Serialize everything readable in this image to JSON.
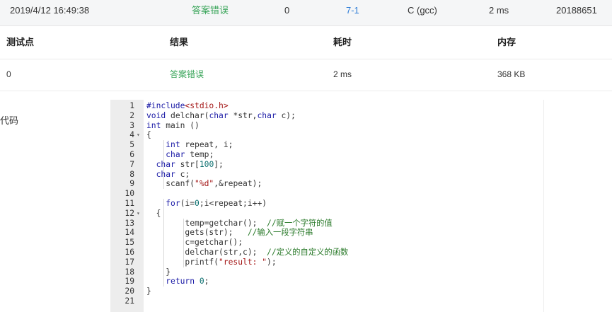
{
  "submission": {
    "time": "2019/4/12 16:49:38",
    "status": "答案错误",
    "score": "0",
    "problem": "7-1",
    "compiler": "C (gcc)",
    "runtime": "2 ms",
    "user": "20188651"
  },
  "table": {
    "headers": [
      "测试点",
      "结果",
      "耗时",
      "内存"
    ],
    "rows": [
      {
        "point": "0",
        "result": "答案错误",
        "time": "2 ms",
        "memory": "368 KB"
      }
    ]
  },
  "code_section": {
    "label": "代码",
    "lines": [
      {
        "n": "1",
        "fold": false,
        "code": "#include<stdio.h>"
      },
      {
        "n": "2",
        "fold": false,
        "code": "void delchar(char *str,char c);"
      },
      {
        "n": "3",
        "fold": false,
        "code": "int main ()"
      },
      {
        "n": "4",
        "fold": true,
        "code": "{"
      },
      {
        "n": "5",
        "fold": false,
        "code": "    int repeat, i;"
      },
      {
        "n": "6",
        "fold": false,
        "code": "    char temp;"
      },
      {
        "n": "7",
        "fold": false,
        "code": "  char str[100];"
      },
      {
        "n": "8",
        "fold": false,
        "code": "  char c;"
      },
      {
        "n": "9",
        "fold": false,
        "code": "    scanf(\"%d\",&repeat);"
      },
      {
        "n": "10",
        "fold": false,
        "code": ""
      },
      {
        "n": "11",
        "fold": false,
        "code": "    for(i=0;i<repeat;i++)"
      },
      {
        "n": "12",
        "fold": true,
        "code": "  {"
      },
      {
        "n": "13",
        "fold": false,
        "code": "        temp=getchar();  //赋一个字符的值"
      },
      {
        "n": "14",
        "fold": false,
        "code": "        gets(str);   //输入一段字符串"
      },
      {
        "n": "15",
        "fold": false,
        "code": "        c=getchar();"
      },
      {
        "n": "16",
        "fold": false,
        "code": "        delchar(str,c);  //定义的自定义的函数"
      },
      {
        "n": "17",
        "fold": false,
        "code": "        printf(\"result: \");"
      },
      {
        "n": "18",
        "fold": false,
        "code": "    }"
      },
      {
        "n": "19",
        "fold": false,
        "code": "    return 0;"
      },
      {
        "n": "20",
        "fold": false,
        "code": "}"
      },
      {
        "n": "21",
        "fold": false,
        "code": ""
      }
    ]
  },
  "colors": {
    "status_error": "#3aa55a",
    "link": "#2a7ad6",
    "keyword": "#1a1aa6",
    "string": "#a31515",
    "comment": "#2a7a2a"
  }
}
